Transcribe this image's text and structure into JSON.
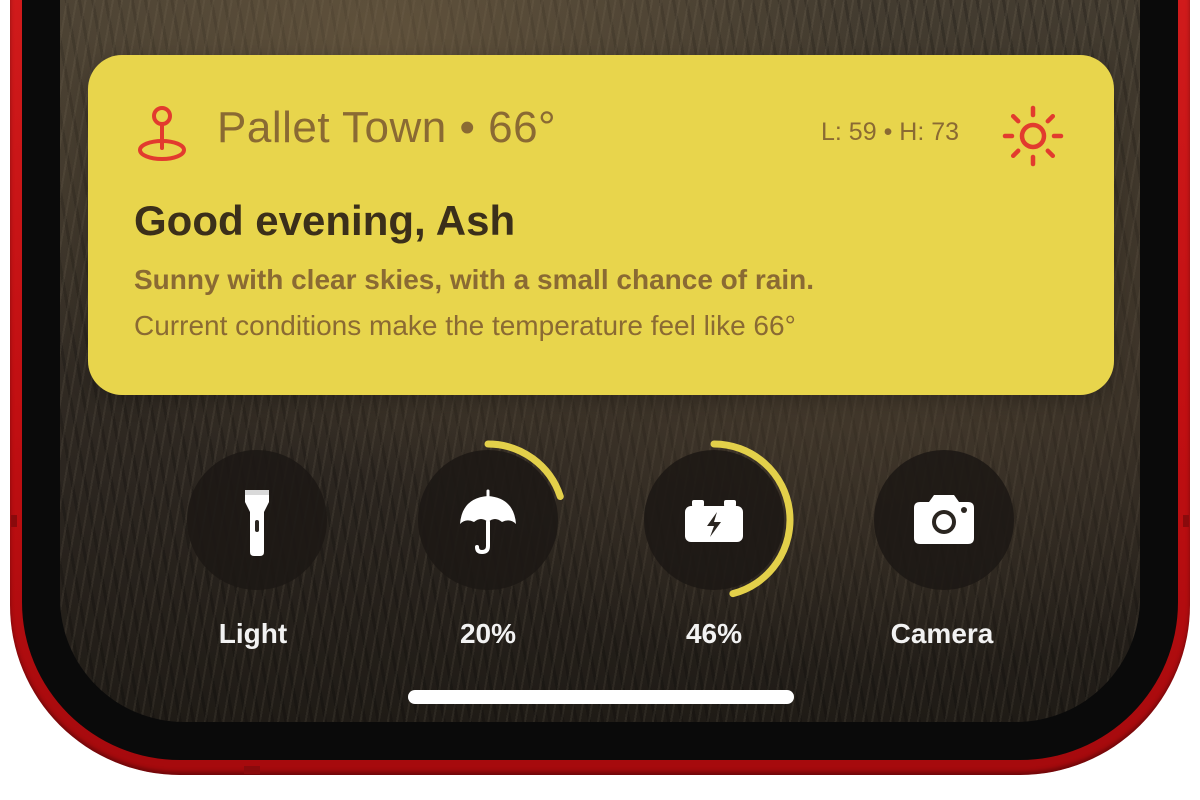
{
  "weather": {
    "location": "Pallet Town",
    "separator": "•",
    "temperature": "66°",
    "low": "L: 59",
    "high": "H: 73",
    "low_high_separator": "•",
    "greeting": "Good evening, Ash",
    "summary": "Sunny with clear skies, with a small chance of rain.",
    "detail": "Current conditions make the temperature feel like 66°",
    "icon": "sun-icon",
    "location_icon": "map-pin-icon"
  },
  "controls": [
    {
      "label": "Light",
      "icon": "flashlight-icon"
    },
    {
      "label": "20%",
      "icon": "umbrella-icon",
      "progress": 0.2
    },
    {
      "label": "46%",
      "icon": "battery-charging-icon",
      "progress": 0.46
    },
    {
      "label": "Camera",
      "icon": "camera-icon"
    }
  ],
  "colors": {
    "card": "#e8d54c",
    "accent_red": "#e23b2e",
    "card_text": "#8a6a33",
    "greeting_text": "#3b2f1a",
    "ring": "#e3d04a",
    "frame": "#c8141a"
  }
}
